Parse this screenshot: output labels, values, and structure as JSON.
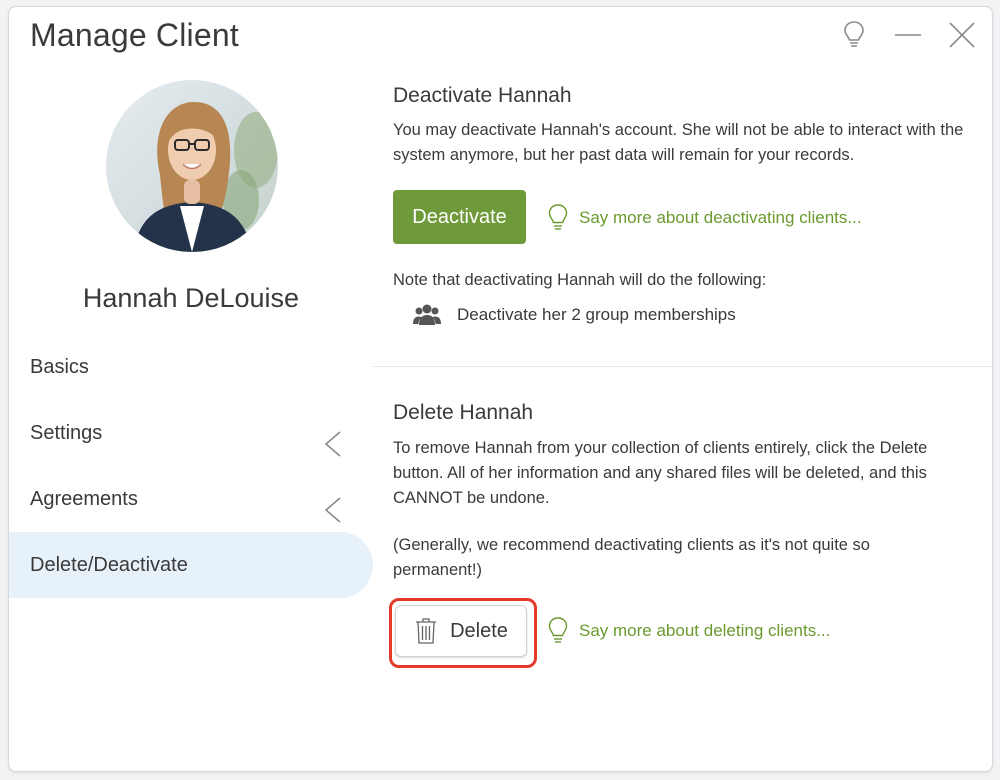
{
  "window": {
    "title": "Manage Client"
  },
  "client": {
    "name": "Hannah DeLouise"
  },
  "nav": {
    "items": [
      {
        "label": "Basics",
        "active": false,
        "chevron": false
      },
      {
        "label": "Settings",
        "active": false,
        "chevron": true
      },
      {
        "label": "Agreements",
        "active": false,
        "chevron": true
      },
      {
        "label": "Delete/Deactivate",
        "active": true,
        "chevron": false
      }
    ]
  },
  "deactivate": {
    "title": "Deactivate Hannah",
    "description": "You may deactivate Hannah's account. She will not be able to interact with the system anymore, but her past data will remain for your records.",
    "button_label": "Deactivate",
    "help_link": "Say more about deactivating clients...",
    "note": "Note that deactivating Hannah will do the following:",
    "effect": "Deactivate her 2 group memberships"
  },
  "delete": {
    "title": "Delete Hannah",
    "description": "To remove Hannah from your collection of clients entirely, click the Delete button. All of her information and any shared files will be deleted, and this CANNOT be undone.",
    "recommendation": "(Generally, we recommend deactivating clients as it's not quite so permanent!)",
    "button_label": "Delete",
    "help_link": "Say more about deleting clients..."
  },
  "colors": {
    "accent_green": "#6f9a3a",
    "link_green": "#6a9a2e",
    "active_nav_bg": "#e7f1f9",
    "highlight_red": "#e53a2a"
  }
}
